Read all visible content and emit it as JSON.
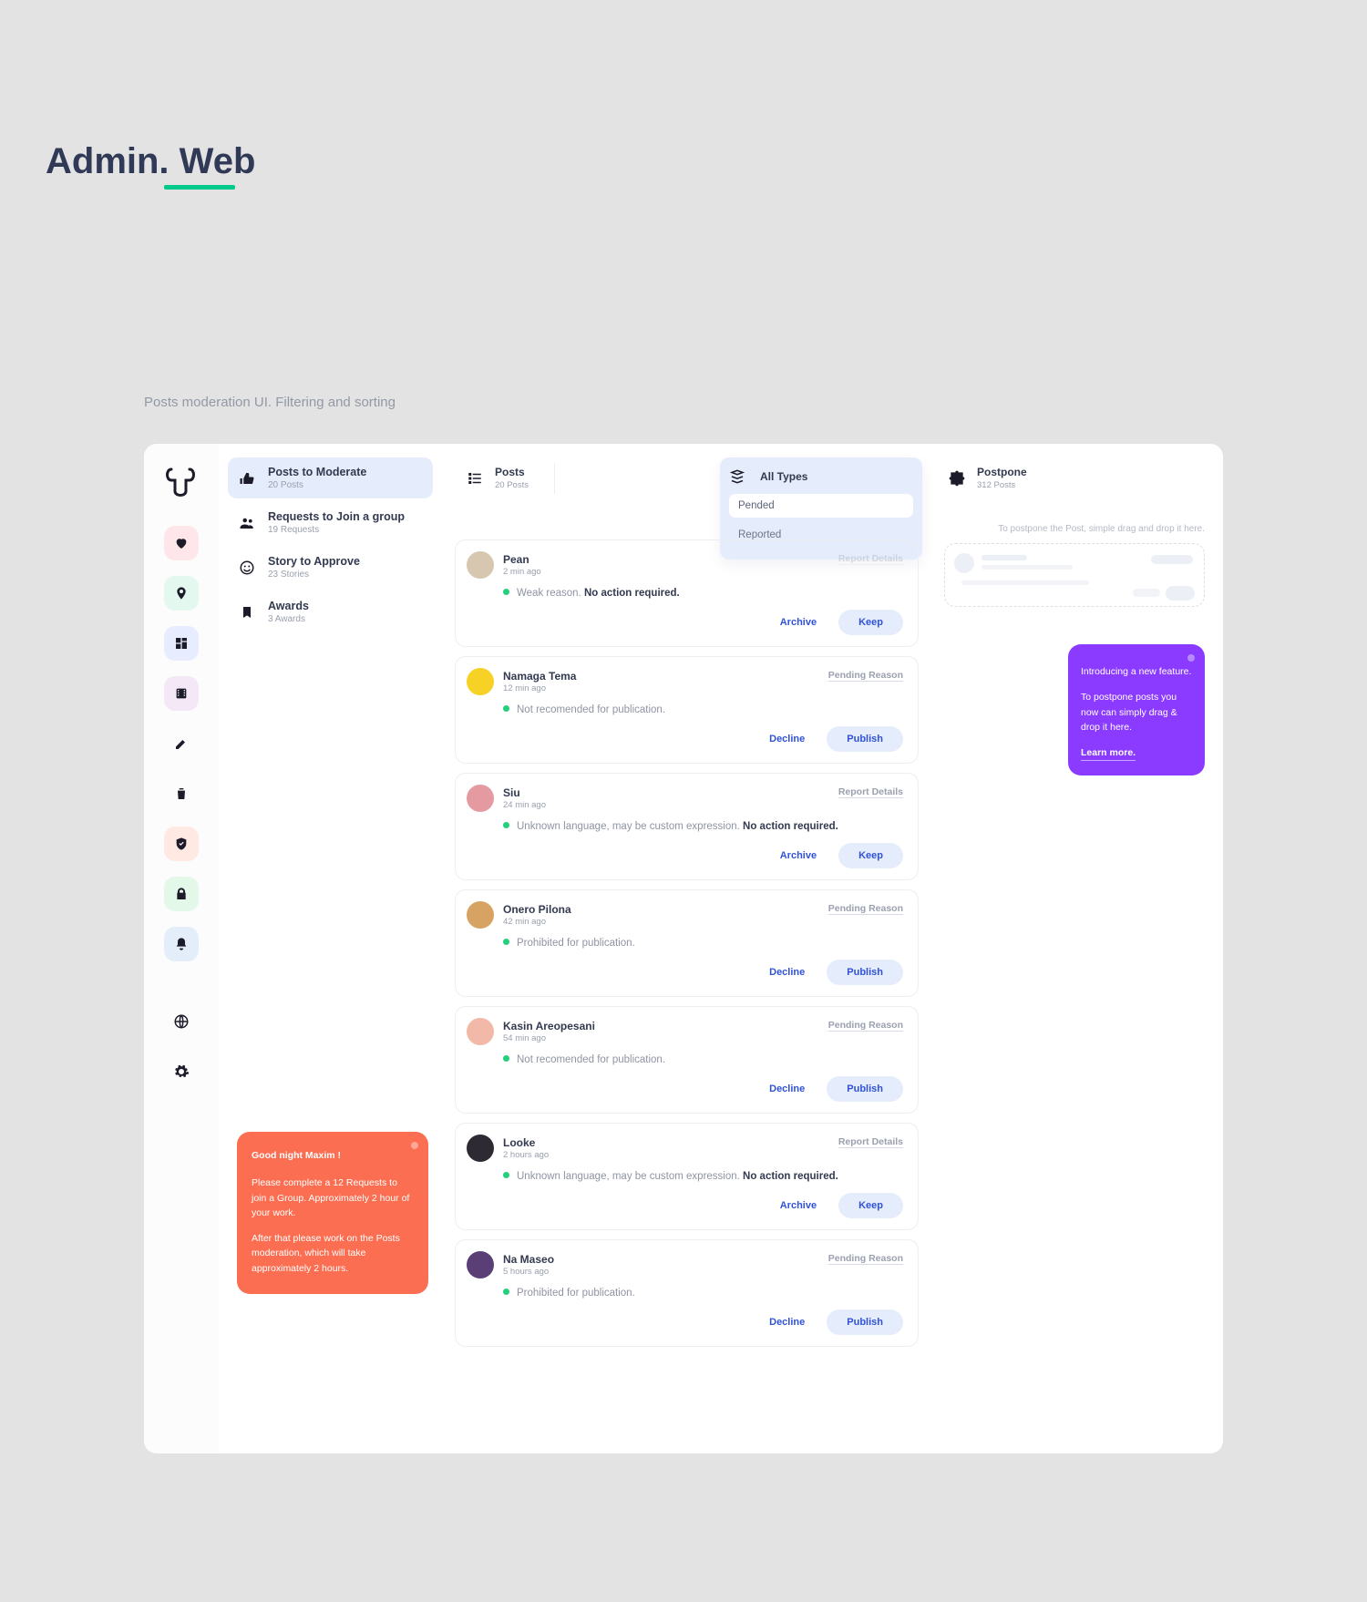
{
  "page": {
    "title": "Admin. Web",
    "subtitle": "Posts moderation UI. Filtering and sorting"
  },
  "rail_icons": [
    "heart-icon",
    "pin-icon",
    "dashboard-icon",
    "film-icon",
    "pencil-icon",
    "trash-icon",
    "shield-check-icon",
    "lock-icon",
    "bell-icon",
    "globe-icon",
    "gear-icon"
  ],
  "queues": [
    {
      "icon": "thumbs-icon",
      "title": "Posts to Moderate",
      "sub": "20 Posts",
      "active": true
    },
    {
      "icon": "group-icon",
      "title": "Requests to Join a group",
      "sub": "19 Requests",
      "active": false
    },
    {
      "icon": "face-icon",
      "title": "Story to Approve",
      "sub": "23 Stories",
      "active": false
    },
    {
      "icon": "bookmark-icon",
      "title": "Awards",
      "sub": "3 Awards",
      "active": false
    }
  ],
  "task_note": {
    "greeting": "Good night Maxim !",
    "line1": "Please complete a 12 Requests to join a Group. Approximately 2 hour of your work.",
    "line2": "After that please work on the Posts moderation, which will take approximately 2 hours."
  },
  "filters": {
    "posts": {
      "title": "Posts",
      "sub": "20 Posts"
    },
    "types": {
      "title": "All Types"
    },
    "options": [
      "Pended",
      "Reported"
    ]
  },
  "postpone_tab": {
    "title": "Postpone",
    "sub": "312 Posts"
  },
  "pp_hint": "To postpone the Post, simple drag and drop it here.",
  "promo": {
    "l1": "Introducing a new feature.",
    "l2": "To postpone posts you now can simply drag & drop it here.",
    "learn": "Learn more."
  },
  "action_labels": {
    "archive": "Archive",
    "keep": "Keep",
    "decline": "Decline",
    "publish": "Publish"
  },
  "posts": [
    {
      "name": "Pean",
      "time": "2 min ago",
      "link": "Report Details",
      "reason_pre": "Weak reason.",
      "reason_bold": "No action required.",
      "primary": "keep",
      "secondary": "archive",
      "avatar": "#d7c6b0",
      "link_faded": true
    },
    {
      "name": "Namaga Tema",
      "time": "12 min ago",
      "link": "Pending Reason",
      "reason_pre": "Not recomended for publication.",
      "reason_bold": "",
      "primary": "publish",
      "secondary": "decline",
      "avatar": "#f6d227"
    },
    {
      "name": "Siu",
      "time": "24 min ago",
      "link": "Report Details",
      "reason_pre": "Unknown language, may be custom expression.",
      "reason_bold": "No action required.",
      "primary": "keep",
      "secondary": "archive",
      "avatar": "#e59aa1"
    },
    {
      "name": "Onero Pilona",
      "time": "42 min ago",
      "link": "Pending Reason",
      "reason_pre": "Prohibited for publication.",
      "reason_bold": "",
      "primary": "publish",
      "secondary": "decline",
      "avatar": "#d6a363"
    },
    {
      "name": "Kasin Areopesani",
      "time": "54 min ago",
      "link": "Pending Reason",
      "reason_pre": "Not recomended for publication.",
      "reason_bold": "",
      "primary": "publish",
      "secondary": "decline",
      "avatar": "#f2b9a8"
    },
    {
      "name": "Looke",
      "time": "2 hours ago",
      "link": "Report Details",
      "reason_pre": "Unknown language, may be custom expression.",
      "reason_bold": "No action required.",
      "primary": "keep",
      "secondary": "archive",
      "avatar": "#2e2a33"
    },
    {
      "name": "Na Maseo",
      "time": "5 hours ago",
      "link": "Pending Reason",
      "reason_pre": "Prohibited for publication.",
      "reason_bold": "",
      "primary": "publish",
      "secondary": "decline",
      "avatar": "#5a3f77"
    }
  ]
}
